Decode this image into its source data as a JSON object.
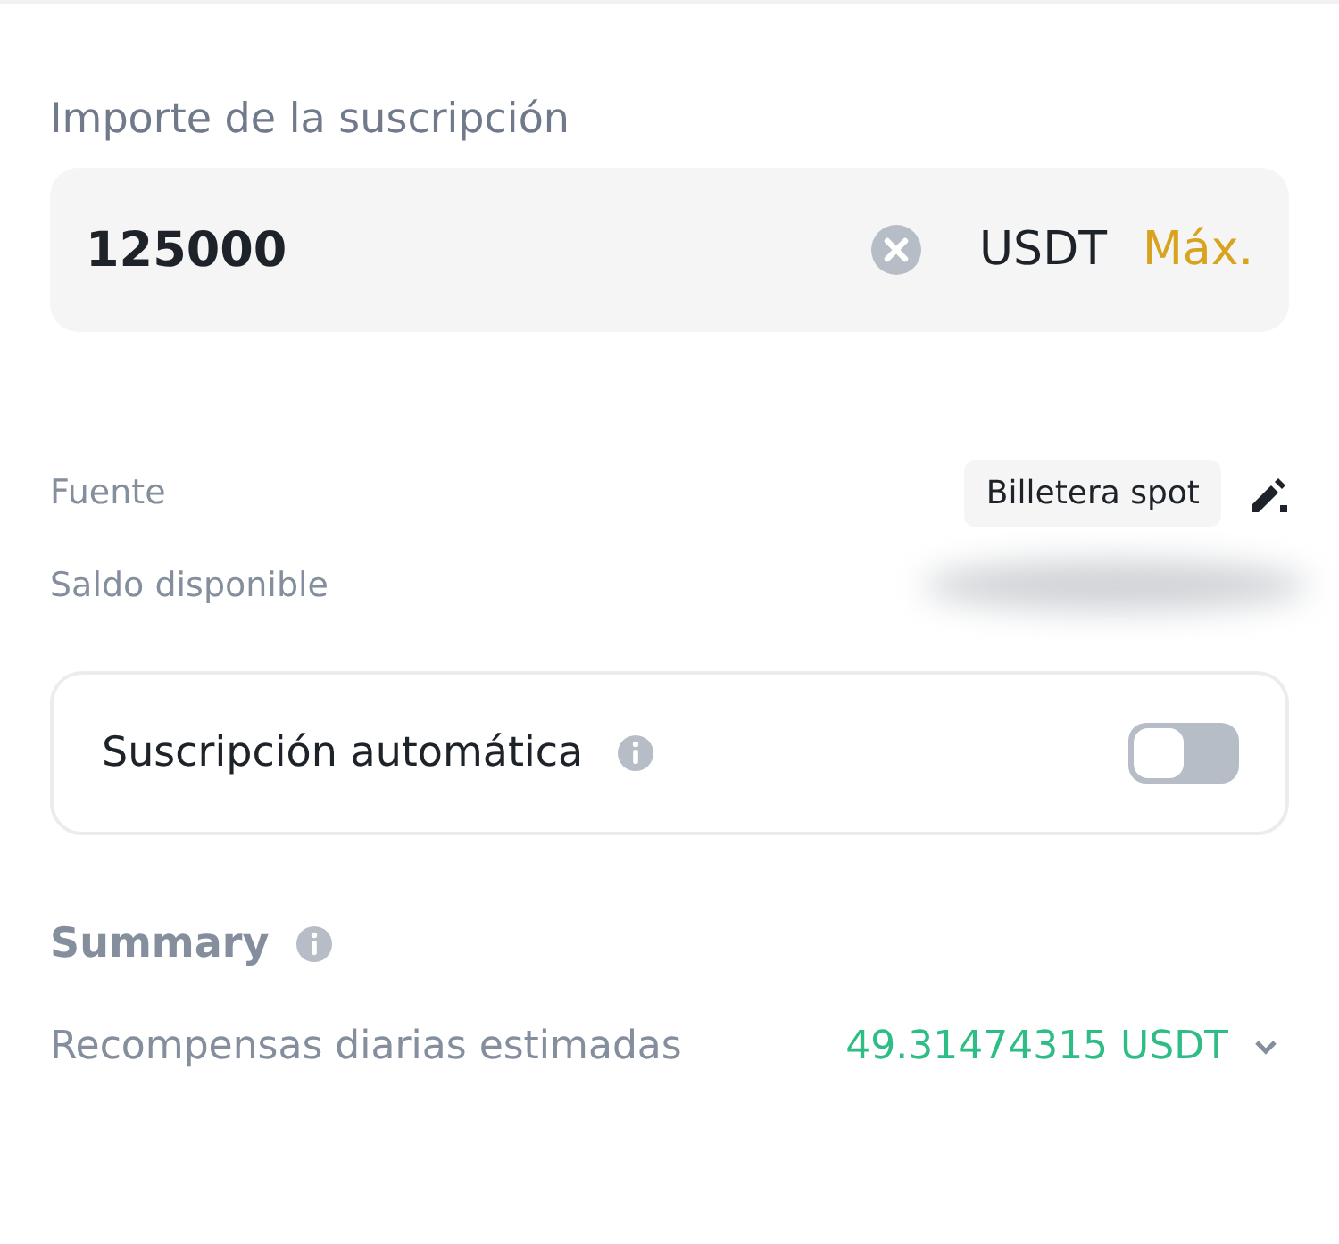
{
  "amount": {
    "label": "Importe de la suscripción",
    "value": "125000",
    "currency": "USDT",
    "max": "Máx."
  },
  "source": {
    "label": "Fuente",
    "value": "Billetera spot"
  },
  "balance": {
    "label": "Saldo disponible"
  },
  "auto_subscription": {
    "label": "Suscripción automática",
    "on": false
  },
  "summary": {
    "title": "Summary",
    "rows": [
      {
        "label": "Recompensas diarias estimadas",
        "value": "49.31474315 USDT"
      }
    ]
  }
}
